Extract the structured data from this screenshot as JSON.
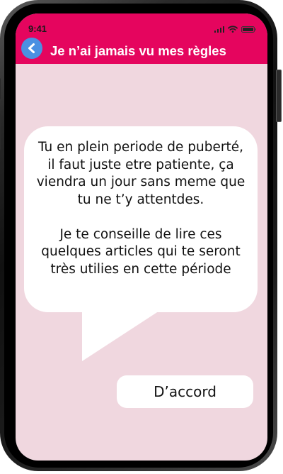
{
  "status_bar": {
    "time": "9:41",
    "icons": [
      "signal-icon",
      "wifi-icon",
      "battery-icon"
    ]
  },
  "header": {
    "title": "Je n’ai jamais vu mes règles",
    "back_icon": "chevron-left-icon",
    "background_color": "#e5055e",
    "back_button_color": "#4a90e2"
  },
  "message": {
    "lines_1": [
      "Tu en plein periode de puberté,",
      "il faut juste etre patiente, ça",
      "viendra un jour sans meme que",
      "tu ne t’y attentdes."
    ],
    "lines_2": [
      "Je te conseille de lire ces",
      "quelques articles qui te seront",
      "très utilies en cette période"
    ]
  },
  "reply_button": {
    "label": "D’accord"
  },
  "colors": {
    "screen_background": "#f0d7df",
    "bubble": "#ffffff"
  }
}
